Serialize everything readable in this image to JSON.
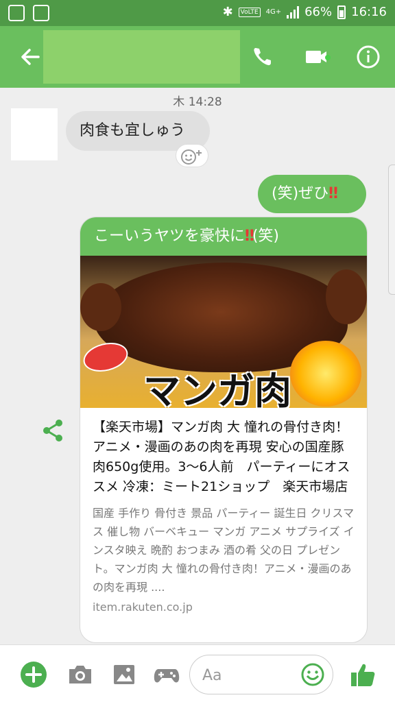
{
  "status_bar": {
    "network": "VoLTE",
    "lte": "4G+",
    "battery": "66%",
    "time": "16:16"
  },
  "header": {
    "contact_name": ""
  },
  "chat": {
    "timestamp": "木 14:28",
    "incoming_message": "肉食も宜しゅう",
    "outgoing_message_text": "(笑)ぜひ",
    "outgoing_message_emoji": "‼"
  },
  "link_card": {
    "title_before": "こーいうヤツを豪快に",
    "title_emoji": "‼",
    "title_after": "(笑)",
    "image_caption": "マンガ肉",
    "heading": "【楽天市場】マンガ肉 大 憧れの骨付き肉！アニメ・漫画のあの肉を再現 安心の国産豚肉650g使用。3〜6人前　パーティーにオススメ 冷凍：ミート21ショップ　楽天市場店",
    "description": "国産 手作り 骨付き 景品 パーティー 誕生日 クリスマス 催し物 バーベキュー マンガ アニメ サプライズ インスタ映え 晩酌 おつまみ 酒の肴 父の日 プレゼント。マンガ肉 大 憧れの骨付き肉！アニメ・漫画のあの肉を再現 ....",
    "url": "item.rakuten.co.jp"
  },
  "input": {
    "placeholder": "Aa"
  },
  "colors": {
    "header_green": "#6abf5e",
    "status_green": "#4f9a47",
    "bubble_green": "#6abf5e"
  }
}
